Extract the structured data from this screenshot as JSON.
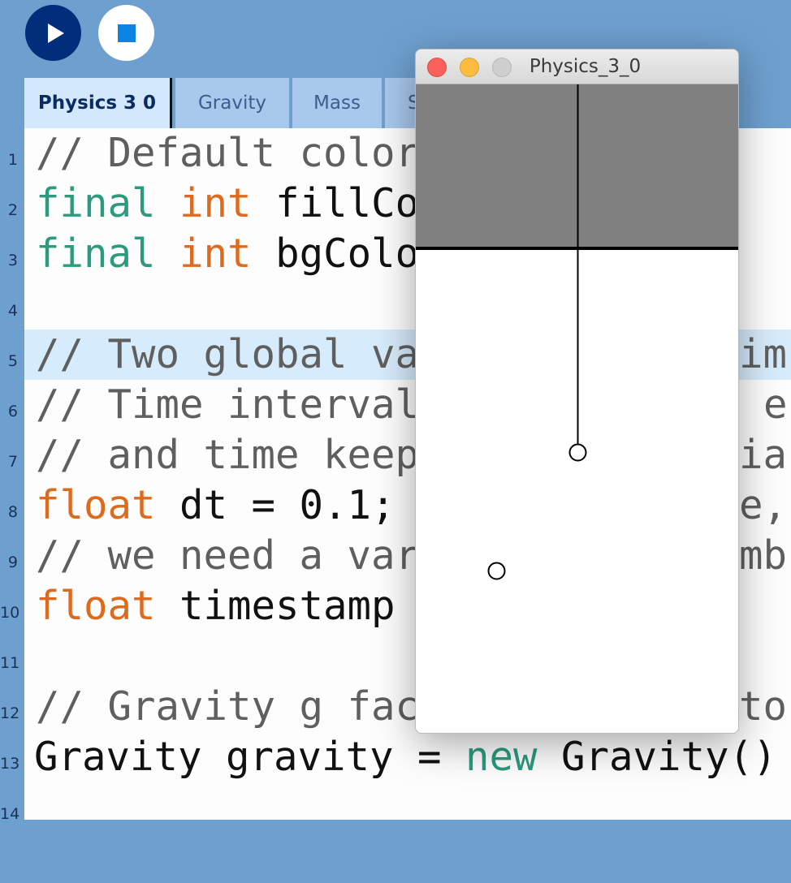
{
  "toolbar": {
    "run_icon": "play-icon",
    "stop_icon": "stop-icon",
    "run_color": "#002e7a",
    "stop_color": "#0d84e4"
  },
  "tabs": [
    {
      "label": "Physics 3 0",
      "active": true
    },
    {
      "label": "Gravity",
      "active": false
    },
    {
      "label": "Mass",
      "active": false
    },
    {
      "label": "S",
      "active": false
    }
  ],
  "editor": {
    "highlighted_line": 5,
    "lines": [
      {
        "n": "1"
      },
      {
        "n": "2"
      },
      {
        "n": "3"
      },
      {
        "n": "4"
      },
      {
        "n": "5"
      },
      {
        "n": "6"
      },
      {
        "n": "7"
      },
      {
        "n": "8"
      },
      {
        "n": "9"
      },
      {
        "n": "10"
      },
      {
        "n": "11"
      },
      {
        "n": "12"
      },
      {
        "n": "13"
      },
      {
        "n": "14"
      }
    ],
    "code": {
      "l1": "// Default color",
      "l2_k": "final",
      "l2_t": "int",
      "l2_r": "fillCo",
      "l3_k": "final",
      "l3_t": "int",
      "l3_r": "bgColo",
      "l5_a": "// Two global va",
      "l5_b": "im",
      "l6_a": "// Time interval",
      "l6_b": "e",
      "l7_a": "// and time keep",
      "l7_b": "ia",
      "l8_t": "float",
      "l8_r": "dt = 0.1;",
      "l8_c": "e,",
      "l9_a": "// we need a var",
      "l9_b": "mb",
      "l10_t": "float",
      "l10_r": "timestamp",
      "l12_a": "// Gravity g fac",
      "l12_b": "to",
      "l13_a": "Gravity gravity = ",
      "l13_k": "new",
      "l13_b": " Gravity()"
    }
  },
  "sketch_window": {
    "title": "Physics_3_0",
    "colors": {
      "ceiling": "#808080",
      "background": "#ffffff",
      "line": "#000000"
    }
  }
}
